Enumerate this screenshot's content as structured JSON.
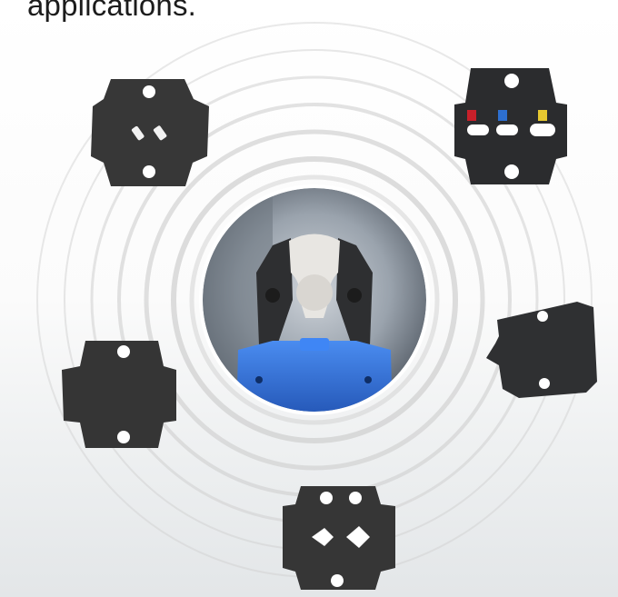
{
  "caption": {
    "text": "applications."
  },
  "scene": {
    "center_subject": "crimping-tool-head",
    "tool_color": "#2f6fd8",
    "die_color": "#333333",
    "ring_color": "#c9c9c9",
    "dies": [
      {
        "name": "die-top-left",
        "marks": []
      },
      {
        "name": "die-top-right",
        "marks": [
          "red",
          "blue",
          "yellow"
        ]
      },
      {
        "name": "die-mid-left",
        "marks": []
      },
      {
        "name": "die-mid-right",
        "marks": []
      },
      {
        "name": "die-bottom",
        "marks": []
      }
    ],
    "mark_colors": {
      "red": "#c8202a",
      "blue": "#2d6fd0",
      "yellow": "#e6c830"
    }
  }
}
